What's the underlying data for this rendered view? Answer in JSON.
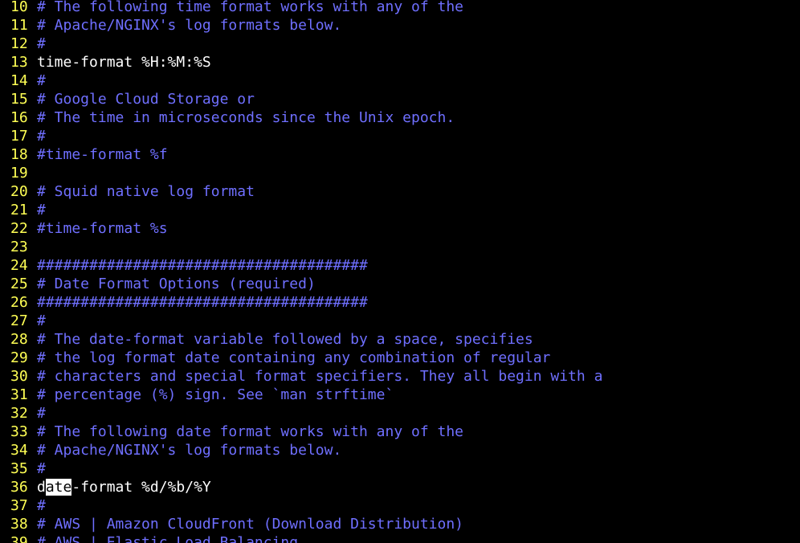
{
  "editor": {
    "colors": {
      "background": "#000000",
      "line_number": "#ffff54",
      "comment": "#6f6fff",
      "plain_text": "#ffffff",
      "search_highlight_bg": "#ffffff",
      "search_highlight_fg": "#000000"
    },
    "lines": [
      {
        "num": "10",
        "kind": "comment",
        "text": "# The following time format works with any of the"
      },
      {
        "num": "11",
        "kind": "comment",
        "text": "# Apache/NGINX's log formats below."
      },
      {
        "num": "12",
        "kind": "comment",
        "text": "#"
      },
      {
        "num": "13",
        "kind": "plain",
        "text": "time-format %H:%M:%S"
      },
      {
        "num": "14",
        "kind": "comment",
        "text": "#"
      },
      {
        "num": "15",
        "kind": "comment",
        "text": "# Google Cloud Storage or"
      },
      {
        "num": "16",
        "kind": "comment",
        "text": "# The time in microseconds since the Unix epoch."
      },
      {
        "num": "17",
        "kind": "comment",
        "text": "#"
      },
      {
        "num": "18",
        "kind": "comment",
        "text": "#time-format %f"
      },
      {
        "num": "19",
        "kind": "plain",
        "text": ""
      },
      {
        "num": "20",
        "kind": "comment",
        "text": "# Squid native log format"
      },
      {
        "num": "21",
        "kind": "comment",
        "text": "#"
      },
      {
        "num": "22",
        "kind": "comment",
        "text": "#time-format %s"
      },
      {
        "num": "23",
        "kind": "plain",
        "text": ""
      },
      {
        "num": "24",
        "kind": "comment",
        "text": "######################################"
      },
      {
        "num": "25",
        "kind": "comment",
        "text": "# Date Format Options (required)"
      },
      {
        "num": "26",
        "kind": "comment",
        "text": "######################################"
      },
      {
        "num": "27",
        "kind": "comment",
        "text": "#"
      },
      {
        "num": "28",
        "kind": "comment",
        "text": "# The date-format variable followed by a space, specifies"
      },
      {
        "num": "29",
        "kind": "comment",
        "text": "# the log format date containing any combination of regular"
      },
      {
        "num": "30",
        "kind": "comment",
        "text": "# characters and special format specifiers. They all begin with a"
      },
      {
        "num": "31",
        "kind": "comment",
        "text": "# percentage (%) sign. See `man strftime`"
      },
      {
        "num": "32",
        "kind": "comment",
        "text": "#"
      },
      {
        "num": "33",
        "kind": "comment",
        "text": "# The following date format works with any of the"
      },
      {
        "num": "34",
        "kind": "comment",
        "text": "# Apache/NGINX's log formats below."
      },
      {
        "num": "35",
        "kind": "comment",
        "text": "#"
      },
      {
        "num": "36",
        "kind": "plain",
        "text": "date-format %d/%b/%Y",
        "highlight": {
          "before": "d",
          "match": "ate",
          "after": "-format %d/%b/%Y"
        }
      },
      {
        "num": "37",
        "kind": "comment",
        "text": "#"
      },
      {
        "num": "38",
        "kind": "comment",
        "text": "# AWS | Amazon CloudFront (Download Distribution)"
      },
      {
        "num": "39",
        "kind": "comment",
        "text": "# AWS | Elastic Load Balancing"
      }
    ]
  }
}
